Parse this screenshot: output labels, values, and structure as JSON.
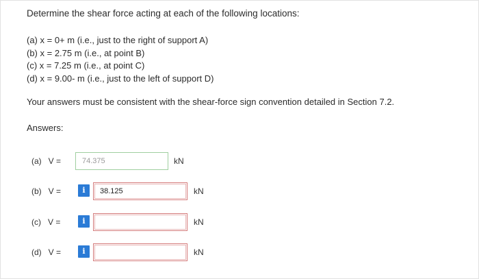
{
  "question": {
    "title": "Determine the shear force acting at each of the following locations:",
    "items": [
      "(a) x = 0+ m (i.e., just to the right of support A)",
      "(b) x = 2.75 m (i.e., at point B)",
      "(c) x = 7.25 m (i.e., at point C)",
      "(d) x = 9.00- m (i.e., just to the left of support D)"
    ],
    "note": "Your answers must be consistent with the shear-force sign convention detailed in Section 7.2.",
    "answers_label": "Answers:"
  },
  "answers": [
    {
      "part": "(a)",
      "var": "V =",
      "value": "74.375",
      "unit": "kN",
      "locked": true
    },
    {
      "part": "(b)",
      "var": "V =",
      "value": "38.125",
      "unit": "kN",
      "locked": false,
      "info": "i"
    },
    {
      "part": "(c)",
      "var": "V =",
      "value": "",
      "unit": "kN",
      "locked": false,
      "info": "i"
    },
    {
      "part": "(d)",
      "var": "V =",
      "value": "",
      "unit": "kN",
      "locked": false,
      "info": "i"
    }
  ],
  "colors": {
    "info_button": "#2b7bd6",
    "input_border_error": "#d47b7b",
    "locked_border": "#9fcf9f"
  }
}
